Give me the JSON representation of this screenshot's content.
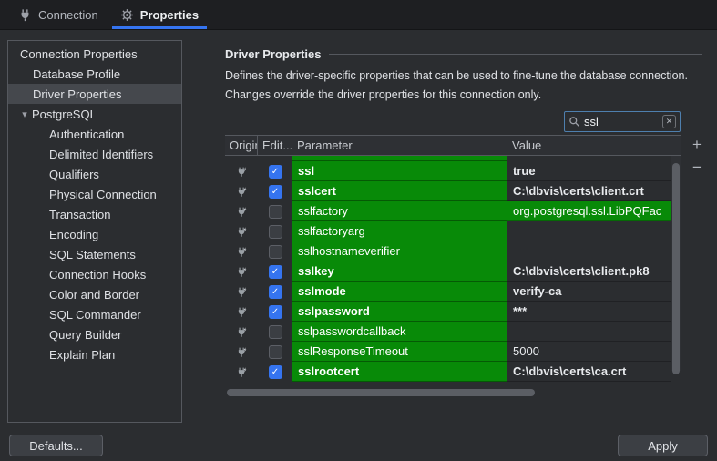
{
  "colors": {
    "accent": "#3574f0",
    "green": "#088a08",
    "selection": "#45484d"
  },
  "window": {
    "tabs": [
      {
        "label": "Connection",
        "icon": "connection-icon",
        "selected": false
      },
      {
        "label": "Properties",
        "icon": "gear-icon",
        "selected": true
      }
    ]
  },
  "sidebar": {
    "items": [
      {
        "label": "Connection Properties",
        "level": 0
      },
      {
        "label": "Database Profile",
        "level": 1
      },
      {
        "label": "Driver Properties",
        "level": 1,
        "selected": true
      },
      {
        "label": "PostgreSQL",
        "level": 1,
        "expanded": true
      },
      {
        "label": "Authentication",
        "level": 2
      },
      {
        "label": "Delimited Identifiers",
        "level": 2
      },
      {
        "label": "Qualifiers",
        "level": 2
      },
      {
        "label": "Physical Connection",
        "level": 2
      },
      {
        "label": "Transaction",
        "level": 2
      },
      {
        "label": "Encoding",
        "level": 2
      },
      {
        "label": "SQL Statements",
        "level": 2
      },
      {
        "label": "Connection Hooks",
        "level": 2
      },
      {
        "label": "Color and Border",
        "level": 2
      },
      {
        "label": "SQL Commander",
        "level": 2
      },
      {
        "label": "Query Builder",
        "level": 2
      },
      {
        "label": "Explain Plan",
        "level": 2
      }
    ]
  },
  "main": {
    "title": "Driver Properties",
    "description": [
      "Defines the driver-specific properties that can be used to fine-tune the database connection.",
      "Changes override the driver properties for this connection only."
    ],
    "search": {
      "value": "ssl"
    },
    "table": {
      "columns": [
        "Origin",
        "Edit...",
        "Parameter",
        "Value"
      ],
      "rows": [
        {
          "origin": "driver",
          "edited": true,
          "parameter": "ssl",
          "value": "true",
          "value_matched": false
        },
        {
          "origin": "driver",
          "edited": true,
          "parameter": "sslcert",
          "value": "C:\\dbvis\\certs\\client.crt",
          "value_matched": false
        },
        {
          "origin": "driver",
          "edited": false,
          "parameter": "sslfactory",
          "value": "org.postgresql.ssl.LibPQFac",
          "value_matched": true
        },
        {
          "origin": "driver",
          "edited": false,
          "parameter": "sslfactoryarg",
          "value": "",
          "value_matched": false
        },
        {
          "origin": "driver",
          "edited": false,
          "parameter": "sslhostnameverifier",
          "value": "",
          "value_matched": false
        },
        {
          "origin": "driver",
          "edited": true,
          "parameter": "sslkey",
          "value": "C:\\dbvis\\certs\\client.pk8",
          "value_matched": false
        },
        {
          "origin": "driver",
          "edited": true,
          "parameter": "sslmode",
          "value": "verify-ca",
          "value_matched": false
        },
        {
          "origin": "driver",
          "edited": true,
          "parameter": "sslpassword",
          "value": "***",
          "value_matched": false
        },
        {
          "origin": "driver",
          "edited": false,
          "parameter": "sslpasswordcallback",
          "value": "",
          "value_matched": false
        },
        {
          "origin": "driver",
          "edited": false,
          "parameter": "sslResponseTimeout",
          "value": "5000",
          "value_matched": false
        },
        {
          "origin": "driver",
          "edited": true,
          "parameter": "sslrootcert",
          "value": "C:\\dbvis\\certs\\ca.crt",
          "value_matched": false
        }
      ],
      "add_label": "+",
      "remove_label": "−"
    }
  },
  "footer": {
    "defaults_label": "Defaults...",
    "apply_label": "Apply"
  }
}
